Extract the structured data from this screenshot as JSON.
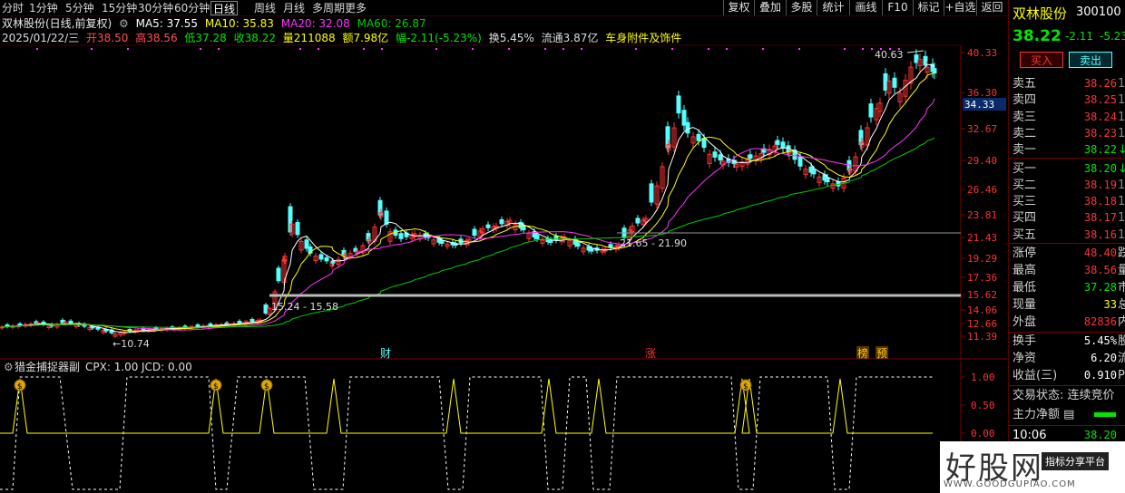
{
  "periods": [
    "分时",
    "1分钟",
    "5分钟",
    "15分钟",
    "30分钟",
    "60分钟",
    "日线",
    "周线",
    "月线",
    "多周期",
    "更多"
  ],
  "active_period": "日线",
  "toolbar": [
    "复权",
    "叠加",
    "多股",
    "统计",
    "画线",
    "F10",
    "标记",
    "+自选",
    "返回"
  ],
  "header": {
    "title": "双林股份(日线,前复权)",
    "ma5": "MA5: 37.55",
    "ma10": "MA10: 35.83",
    "ma20": "MA20: 32.08",
    "ma60": "MA60: 26.87"
  },
  "info_line": {
    "date": "2025/01/22/三",
    "open": "开38.50",
    "high": "高38.56",
    "low": "低37.28",
    "close": "收38.22",
    "volume": "量211088",
    "amount": "额7.98亿",
    "change": "幅-2.11(-5.23%)",
    "turnover": "换5.45%",
    "float": "流通3.87亿",
    "sector": "车身附件及饰件"
  },
  "price_axis": [
    "40.33",
    "36.30",
    "32.67",
    "29.40",
    "26.46",
    "23.81",
    "21.43",
    "19.29",
    "17.36",
    "15.62",
    "14.06",
    "12.66",
    "11.39"
  ],
  "price_marker": "34.33",
  "annotations": {
    "high_label": "40.63",
    "low_label": "10.74",
    "gap1": "15.24 - 15.58",
    "gap2": "21.65 - 21.90"
  },
  "event_tags": [
    "财",
    "涨",
    "榜",
    "预"
  ],
  "indicator": {
    "name": "猎金捕捉器副",
    "cpx": "CPX: 1.00",
    "jcd": "JCD: 0.00",
    "axis": [
      "1.00",
      "0.50",
      "0.00"
    ]
  },
  "colors": {
    "ma5": "#ffffff",
    "ma10": "#ffff00",
    "ma20": "#ff33ff",
    "ma60": "#00cc00",
    "up": "#ff3232",
    "down": "#54ffff",
    "price_up": "#ff3232",
    "price_down": "#00e600"
  },
  "quote": {
    "name": "双林股份",
    "code": "300100",
    "price": "38.22",
    "change": "-2.11",
    "pct": "-5.23",
    "buy_btn": "买入",
    "sell_btn": "卖出",
    "asks": [
      {
        "label": "卖五",
        "price": "38.26",
        "tail": "1"
      },
      {
        "label": "卖四",
        "price": "38.25",
        "tail": "1"
      },
      {
        "label": "卖三",
        "price": "38.24",
        "tail": "1"
      },
      {
        "label": "卖二",
        "price": "38.23",
        "tail": "1"
      },
      {
        "label": "卖一",
        "price": "38.22",
        "tail": "↓"
      }
    ],
    "bids": [
      {
        "label": "买一",
        "price": "38.20",
        "tail": "↓"
      },
      {
        "label": "买二",
        "price": "38.19",
        "tail": "1"
      },
      {
        "label": "买三",
        "price": "38.18",
        "tail": "1"
      },
      {
        "label": "买四",
        "price": "38.17",
        "tail": "1"
      },
      {
        "label": "买五",
        "price": "38.16",
        "tail": "1"
      }
    ],
    "stats": [
      {
        "label": "涨停",
        "value": "48.40",
        "tail": "跌"
      },
      {
        "label": "最高",
        "value": "38.56",
        "tail": "量"
      },
      {
        "label": "最低",
        "value": "37.28",
        "tail": "市"
      },
      {
        "label": "现量",
        "value": "33",
        "tail": "总"
      },
      {
        "label": "外盘",
        "value": "82836",
        "tail": "内"
      }
    ],
    "stats2": [
      {
        "label": "换手",
        "value": "5.45%",
        "tail": "股"
      },
      {
        "label": "净资",
        "value": "6.20",
        "tail": "流"
      },
      {
        "label": "收益(三)",
        "value": "0.910",
        "tail": "P"
      }
    ],
    "trade_status": "交易状态: 连续竞价",
    "net_flow": "主力净额",
    "time": "10:06",
    "time_price": "38.20"
  },
  "watermark": {
    "big": "好股网",
    "tag": "指标分享平台",
    "url": "WWW.GOODGUPIAO.COM"
  }
}
